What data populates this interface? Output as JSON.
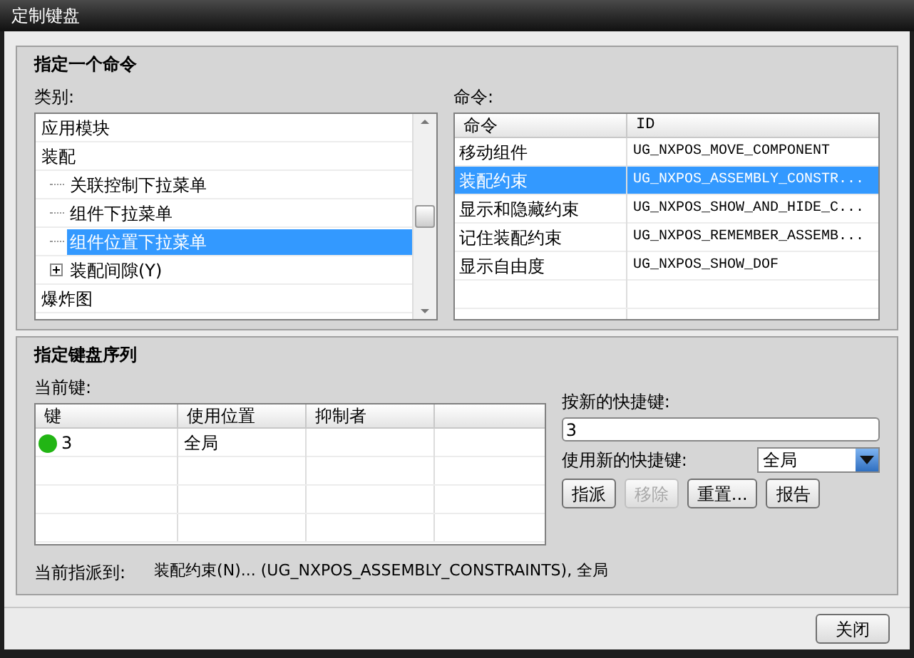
{
  "window": {
    "title": "定制键盘"
  },
  "command_section": {
    "title": "指定一个命令",
    "category_label": "类别:",
    "commands_label": "命令:"
  },
  "categories": [
    {
      "label": "应用模块",
      "selected": false
    },
    {
      "label": "装配",
      "selected": false,
      "children": [
        {
          "label": "关联控制下拉菜单",
          "selected": false
        },
        {
          "label": "组件下拉菜单",
          "selected": false
        },
        {
          "label": "组件位置下拉菜单",
          "selected": true
        },
        {
          "label": "装配间隙(Y)",
          "selected": false,
          "expanded": false
        }
      ]
    },
    {
      "label": "爆炸图",
      "selected": false
    }
  ],
  "commands_table": {
    "columns": [
      "命令",
      "ID"
    ],
    "rows": [
      {
        "name": "移动组件",
        "id": "UG_NXPOS_MOVE_COMPONENT",
        "selected": false
      },
      {
        "name": "装配约束",
        "id": "UG_NXPOS_ASSEMBLY_CONSTR...",
        "selected": true
      },
      {
        "name": "显示和隐藏约束",
        "id": "UG_NXPOS_SHOW_AND_HIDE_C...",
        "selected": false
      },
      {
        "name": "记住装配约束",
        "id": "UG_NXPOS_REMEMBER_ASSEMB...",
        "selected": false
      },
      {
        "name": "显示自由度",
        "id": "UG_NXPOS_SHOW_DOF",
        "selected": false
      }
    ]
  },
  "key_section": {
    "title": "指定键盘序列",
    "current_keys_label": "当前键:"
  },
  "keys_table": {
    "columns": [
      "键",
      "使用位置",
      "抑制者"
    ],
    "rows": [
      {
        "key": "3",
        "location": "全局",
        "color": "#22b514"
      }
    ]
  },
  "new_shortcut": {
    "label": "按新的快捷键:",
    "value": "3",
    "scope_label": "使用新的快捷键:",
    "scope_value": "全局"
  },
  "actions": [
    {
      "label": "指派",
      "disabled": false
    },
    {
      "label": "移除",
      "disabled": true
    },
    {
      "label": "重置...",
      "disabled": false
    },
    {
      "label": "报告",
      "disabled": false
    }
  ],
  "status": {
    "label": "当前指派到:",
    "value": "装配约束(N)... (UG_NXPOS_ASSEMBLY_CONSTRAINTS), 全局"
  },
  "buttons": [
    "关闭"
  ]
}
